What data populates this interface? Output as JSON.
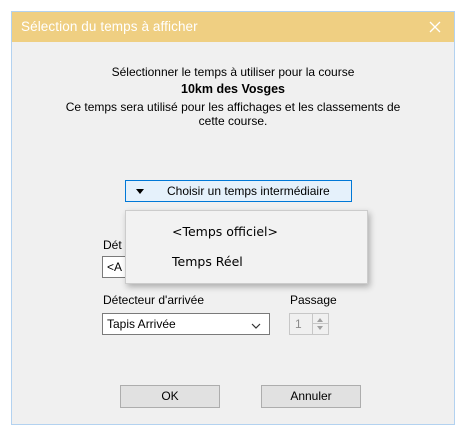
{
  "window": {
    "title": "Sélection du temps à afficher",
    "title_bar_color": "#efcf82"
  },
  "intro": {
    "line1": "Sélectionner le temps à utiliser pour la course",
    "course": "10km des Vosges",
    "line2": "Ce temps sera utilisé pour les affichages et les classements de",
    "line3": "cette course."
  },
  "choose_button": {
    "label": "Choisir un temps intermédiaire"
  },
  "popup_menu": {
    "items": [
      {
        "label": "<Temps officiel>"
      },
      {
        "label": "Temps Réel"
      }
    ]
  },
  "start_row": {
    "label_fragment": "Dét",
    "value_fragment": "<A"
  },
  "arrival": {
    "detector_label": "Détecteur d'arrivée",
    "detector_value": "Tapis Arrivée",
    "pass_label": "Passage",
    "pass_value": "1"
  },
  "buttons": {
    "ok": "OK",
    "cancel": "Annuler"
  }
}
